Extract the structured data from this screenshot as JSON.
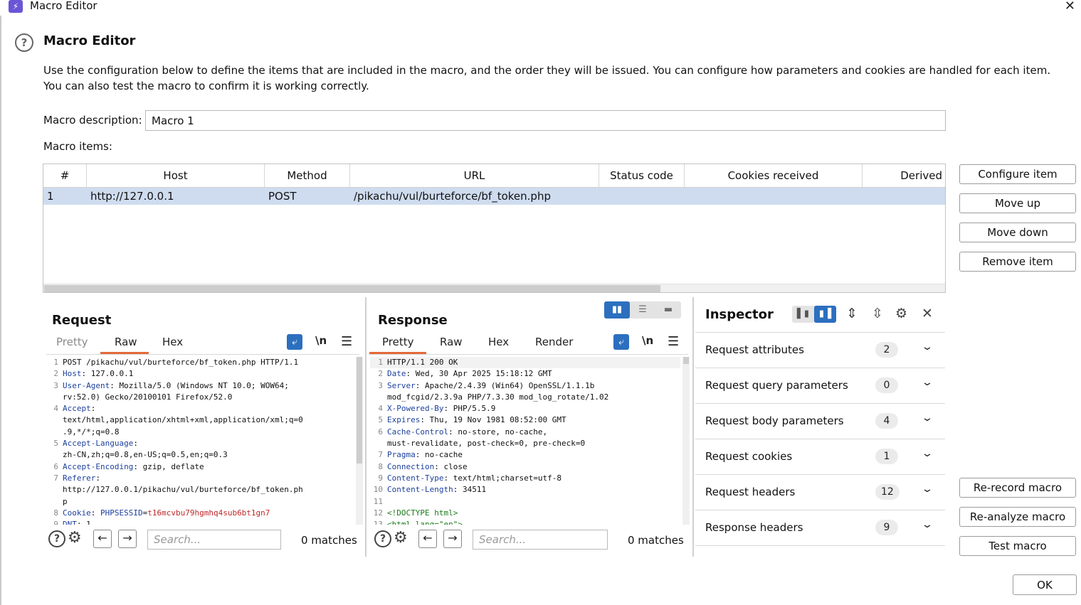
{
  "window": {
    "title": "Macro Editor",
    "icon": "lightning-icon",
    "close_glyph": "✕"
  },
  "header": {
    "title": "Macro Editor",
    "description": "Use the configuration below to define the items that are included in the macro, and the order they will be issued. You can configure how parameters and cookies are handled for each item. You can also test the macro to confirm it is working correctly."
  },
  "form": {
    "description_label": "Macro description:",
    "description_value": "Macro 1",
    "items_label": "Macro items:"
  },
  "table": {
    "columns": [
      "#",
      "Host",
      "Method",
      "URL",
      "Status code",
      "Cookies received",
      "Derived"
    ],
    "rows": [
      {
        "num": "1",
        "host": "http://127.0.0.1",
        "method": "POST",
        "url": "/pikachu/vul/burteforce/bf_token.php",
        "status": "",
        "cookies": "",
        "derived": ""
      }
    ]
  },
  "side_buttons": {
    "configure": "Configure item",
    "move_up": "Move up",
    "move_down": "Move down",
    "remove": "Remove item",
    "rerecord": "Re-record macro",
    "reanalyze": "Re-analyze macro",
    "test": "Test macro"
  },
  "request": {
    "title": "Request",
    "tabs": [
      "Pretty",
      "Raw",
      "Hex"
    ],
    "active_tab": "Raw",
    "newline_label": "\\n",
    "search_placeholder": "Search...",
    "matches": "0 matches"
  },
  "response": {
    "title": "Response",
    "tabs": [
      "Pretty",
      "Raw",
      "Hex",
      "Render"
    ],
    "active_tab": "Pretty",
    "newline_label": "\\n",
    "search_placeholder": "Search...",
    "matches": "0 matches"
  },
  "inspector": {
    "title": "Inspector",
    "rows": [
      {
        "label": "Request attributes",
        "count": "2"
      },
      {
        "label": "Request query parameters",
        "count": "0"
      },
      {
        "label": "Request body parameters",
        "count": "4"
      },
      {
        "label": "Request cookies",
        "count": "1"
      },
      {
        "label": "Request headers",
        "count": "12"
      },
      {
        "label": "Response headers",
        "count": "9"
      }
    ]
  },
  "footer": {
    "ok": "OK"
  },
  "colors": {
    "accent": "#2c6fbf",
    "tab_underline": "#e4693a",
    "selected_row": "#cfdcef"
  }
}
